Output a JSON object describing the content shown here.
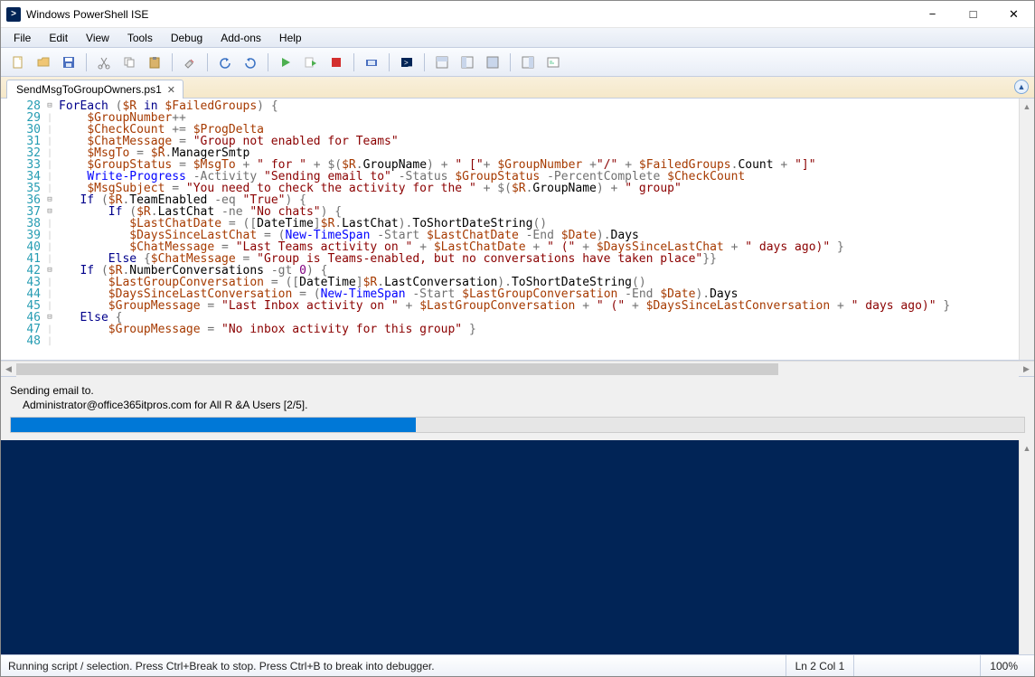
{
  "window": {
    "title": "Windows PowerShell ISE"
  },
  "menu": [
    "File",
    "Edit",
    "View",
    "Tools",
    "Debug",
    "Add-ons",
    "Help"
  ],
  "tab": {
    "name": "SendMsgToGroupOwners.ps1"
  },
  "lines": {
    "start": 28,
    "end": 48
  },
  "progress": {
    "activity": "Sending email to.",
    "status": "Administrator@office365itpros.com for All R &A Users [2/5].",
    "percent": 40
  },
  "statusBar": {
    "message": "Running script / selection.  Press Ctrl+Break to stop.  Press Ctrl+B to break into debugger.",
    "position": "Ln 2  Col 1",
    "zoom": "100%"
  },
  "code": [
    {
      "n": 28,
      "fold": "-",
      "html": "<span class='kw'>ForEach</span> <span class='op'>(</span><span class='var'>$R</span> <span class='kw'>in</span> <span class='var'>$FailedGroups</span><span class='op'>) {</span>"
    },
    {
      "n": 29,
      "fold": "",
      "html": "    <span class='var'>$GroupNumber</span><span class='op'>++</span>"
    },
    {
      "n": 30,
      "fold": "",
      "html": "    <span class='var'>$CheckCount</span> <span class='op'>+=</span> <span class='var'>$ProgDelta</span>"
    },
    {
      "n": 31,
      "fold": "",
      "html": "    <span class='var'>$ChatMessage</span> <span class='op'>=</span> <span class='str'>\"Group not enabled for Teams\"</span>"
    },
    {
      "n": 32,
      "fold": "",
      "html": "    <span class='var'>$MsgTo</span> <span class='op'>=</span> <span class='var'>$R</span><span class='op'>.</span><span class='prop'>ManagerSmtp</span>"
    },
    {
      "n": 33,
      "fold": "",
      "html": "    <span class='var'>$GroupStatus</span> <span class='op'>=</span> <span class='var'>$MsgTo</span> <span class='op'>+</span> <span class='str'>\" for \"</span> <span class='op'>+</span> <span class='op'>$(</span><span class='var'>$R</span><span class='op'>.</span><span class='prop'>GroupName</span><span class='op'>)</span> <span class='op'>+</span> <span class='str'>\" [\"</span><span class='op'>+</span> <span class='var'>$GroupNumber</span> <span class='op'>+</span><span class='str'>\"/\"</span> <span class='op'>+</span> <span class='var'>$FailedGroups</span><span class='op'>.</span><span class='prop'>Count</span> <span class='op'>+</span> <span class='str'>\"]\"</span>"
    },
    {
      "n": 34,
      "fold": "",
      "html": "    <span class='cmd'>Write-Progress</span> <span class='op'>-Activity</span> <span class='str'>\"Sending email to\"</span> <span class='op'>-Status</span> <span class='var'>$GroupStatus</span> <span class='op'>-PercentComplete</span> <span class='var'>$CheckCount</span>"
    },
    {
      "n": 35,
      "fold": "",
      "html": "    <span class='var'>$MsgSubject</span> <span class='op'>=</span> <span class='str'>\"You need to check the activity for the \"</span> <span class='op'>+</span> <span class='op'>$(</span><span class='var'>$R</span><span class='op'>.</span><span class='prop'>GroupName</span><span class='op'>)</span> <span class='op'>+</span> <span class='str'>\" group\"</span>"
    },
    {
      "n": 36,
      "fold": "-",
      "html": "   <span class='kw'>If</span> <span class='op'>(</span><span class='var'>$R</span><span class='op'>.</span><span class='prop'>TeamEnabled</span> <span class='op'>-eq</span> <span class='str'>\"True\"</span><span class='op'>) {</span>"
    },
    {
      "n": 37,
      "fold": "-",
      "html": "       <span class='kw'>If</span> <span class='op'>(</span><span class='var'>$R</span><span class='op'>.</span><span class='prop'>LastChat</span> <span class='op'>-ne</span> <span class='str'>\"No chats\"</span><span class='op'>) {</span>"
    },
    {
      "n": 38,
      "fold": "",
      "html": "          <span class='var'>$LastChatDate</span> <span class='op'>=</span> <span class='op'>([</span><span class='prop'>DateTime</span><span class='op'>]</span><span class='var'>$R</span><span class='op'>.</span><span class='prop'>LastChat</span><span class='op'>).</span><span class='prop'>ToShortDateString</span><span class='op'>()</span>"
    },
    {
      "n": 39,
      "fold": "",
      "html": "          <span class='var'>$DaysSinceLastChat</span> <span class='op'>=</span> <span class='op'>(</span><span class='cmd'>New-TimeSpan</span> <span class='op'>-Start</span> <span class='var'>$LastChatDate</span> <span class='op'>-End</span> <span class='var'>$Date</span><span class='op'>).</span><span class='prop'>Days</span>"
    },
    {
      "n": 40,
      "fold": "",
      "html": "          <span class='var'>$ChatMessage</span> <span class='op'>=</span> <span class='str'>\"Last Teams activity on \"</span> <span class='op'>+</span> <span class='var'>$LastChatDate</span> <span class='op'>+</span> <span class='str'>\" (\"</span> <span class='op'>+</span> <span class='var'>$DaysSinceLastChat</span> <span class='op'>+</span> <span class='str'>\" days ago)\"</span> <span class='op'>}</span>"
    },
    {
      "n": 41,
      "fold": "",
      "html": "       <span class='kw'>Else</span> <span class='op'>{</span><span class='var'>$ChatMessage</span> <span class='op'>=</span> <span class='str'>\"Group is Teams-enabled, but no conversations have taken place\"</span><span class='op'>}}</span>"
    },
    {
      "n": 42,
      "fold": "-",
      "html": "   <span class='kw'>If</span> <span class='op'>(</span><span class='var'>$R</span><span class='op'>.</span><span class='prop'>NumberConversations</span> <span class='op'>-gt</span> <span class='num'>0</span><span class='op'>) {</span>"
    },
    {
      "n": 43,
      "fold": "",
      "html": "       <span class='var'>$LastGroupConversation</span> <span class='op'>=</span> <span class='op'>([</span><span class='prop'>DateTime</span><span class='op'>]</span><span class='var'>$R</span><span class='op'>.</span><span class='prop'>LastConversation</span><span class='op'>).</span><span class='prop'>ToShortDateString</span><span class='op'>()</span>"
    },
    {
      "n": 44,
      "fold": "",
      "html": "       <span class='var'>$DaysSinceLastConversation</span> <span class='op'>=</span> <span class='op'>(</span><span class='cmd'>New-TimeSpan</span> <span class='op'>-Start</span> <span class='var'>$LastGroupConversation</span> <span class='op'>-End</span> <span class='var'>$Date</span><span class='op'>).</span><span class='prop'>Days</span>"
    },
    {
      "n": 45,
      "fold": "",
      "html": "       <span class='var'>$GroupMessage</span> <span class='op'>=</span> <span class='str'>\"Last Inbox activity on \"</span> <span class='op'>+</span> <span class='var'>$LastGroupConversation</span> <span class='op'>+</span> <span class='str'>\" (\"</span> <span class='op'>+</span> <span class='var'>$DaysSinceLastConversation</span> <span class='op'>+</span> <span class='str'>\" days ago)\"</span> <span class='op'>}</span>"
    },
    {
      "n": 46,
      "fold": "-",
      "html": "   <span class='kw'>Else</span> <span class='op'>{</span>"
    },
    {
      "n": 47,
      "fold": "",
      "html": "       <span class='var'>$GroupMessage</span> <span class='op'>=</span> <span class='str'>\"No inbox activity for this group\"</span> <span class='op'>}</span>"
    },
    {
      "n": 48,
      "fold": "",
      "html": ""
    }
  ]
}
